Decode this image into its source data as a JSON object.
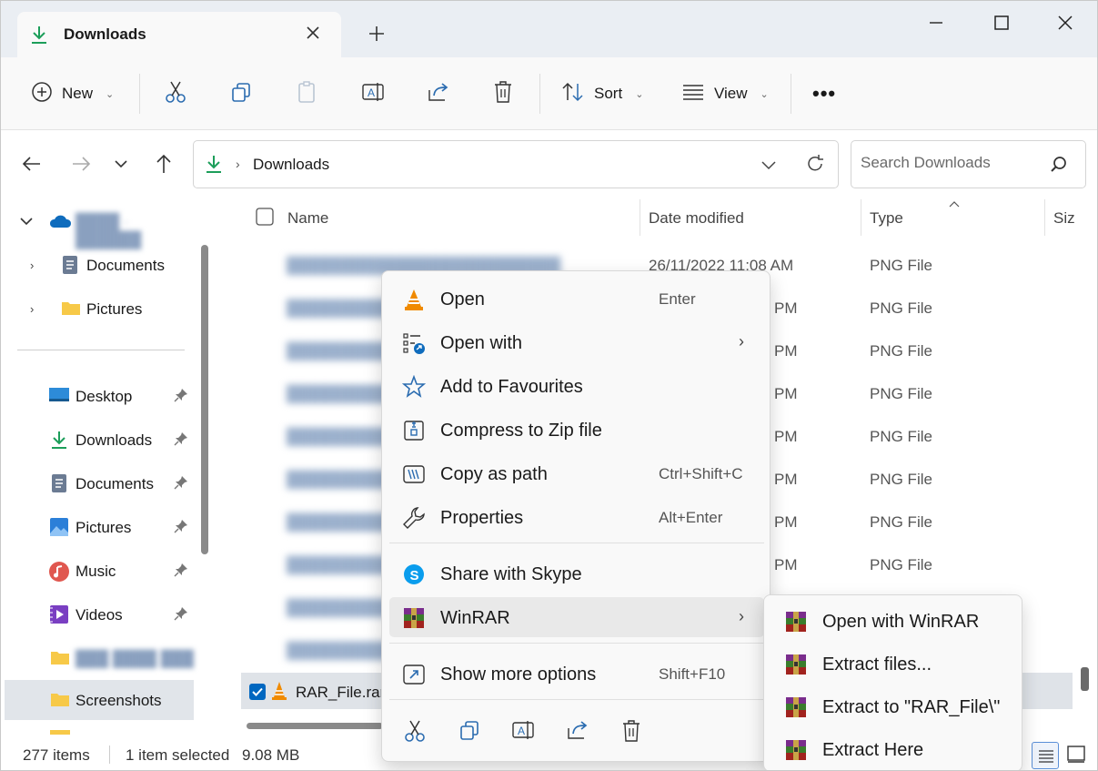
{
  "window": {
    "tab_title": "Downloads",
    "new_tab": "+"
  },
  "toolbar": {
    "new_label": "New",
    "sort_label": "Sort",
    "view_label": "View",
    "more": "•••"
  },
  "address": {
    "path": "Downloads",
    "search_placeholder": "Search Downloads"
  },
  "sidebar": {
    "items": [
      {
        "label": "Documents"
      },
      {
        "label": "Pictures"
      },
      {
        "label": "Desktop"
      },
      {
        "label": "Downloads"
      },
      {
        "label": "Documents"
      },
      {
        "label": "Pictures"
      },
      {
        "label": "Music"
      },
      {
        "label": "Videos"
      },
      {
        "label": "Screenshots"
      }
    ]
  },
  "columns": {
    "name": "Name",
    "date": "Date modified",
    "type": "Type",
    "size": "Siz"
  },
  "files": {
    "rows": [
      {
        "date": "26/11/2022 11:08 AM",
        "type": "PNG File"
      },
      {
        "date": "PM",
        "type": "PNG File"
      },
      {
        "date": "PM",
        "type": "PNG File"
      },
      {
        "date": "PM",
        "type": "PNG File"
      },
      {
        "date": "PM",
        "type": "PNG File"
      },
      {
        "date": "PM",
        "type": "PNG File"
      },
      {
        "date": "PM",
        "type": "PNG File"
      },
      {
        "date": "PM",
        "type": "PNG File"
      }
    ],
    "selected_name": "RAR_File.rar"
  },
  "status": {
    "count": "277 items",
    "selected": "1 item selected",
    "size": "9.08 MB"
  },
  "context_menu": {
    "items": [
      {
        "label": "Open",
        "shortcut": "Enter"
      },
      {
        "label": "Open with",
        "shortcut": ""
      },
      {
        "label": "Add to Favourites",
        "shortcut": ""
      },
      {
        "label": "Compress to Zip file",
        "shortcut": ""
      },
      {
        "label": "Copy as path",
        "shortcut": "Ctrl+Shift+C"
      },
      {
        "label": "Properties",
        "shortcut": "Alt+Enter"
      },
      {
        "label": "Share with Skype",
        "shortcut": ""
      },
      {
        "label": "WinRAR",
        "shortcut": ""
      },
      {
        "label": "Show more options",
        "shortcut": "Shift+F10"
      }
    ],
    "arrow": "›"
  },
  "winrar_submenu": {
    "items": [
      {
        "label": "Open with WinRAR"
      },
      {
        "label": "Extract files..."
      },
      {
        "label": "Extract to \"RAR_File\\\""
      },
      {
        "label": "Extract Here"
      }
    ]
  },
  "colors": {
    "accent": "#0067c0",
    "download_green": "#1c9e5a",
    "vlc_orange": "#f08a00",
    "folder_yellow": "#f7c948"
  }
}
